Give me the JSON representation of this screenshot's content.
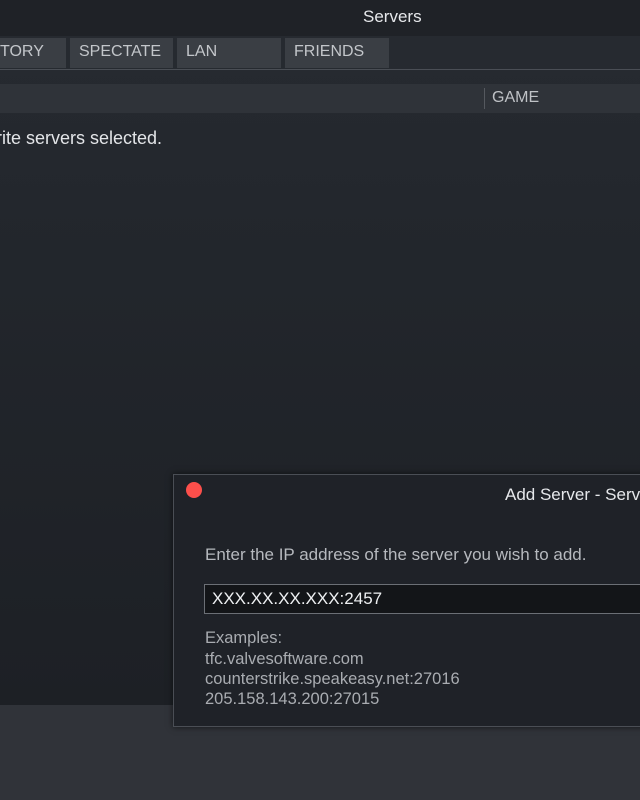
{
  "window": {
    "title": "Servers"
  },
  "tabs": [
    {
      "label": "TORY"
    },
    {
      "label": "SPECTATE"
    },
    {
      "label": "LAN"
    },
    {
      "label": "FRIENDS"
    }
  ],
  "table": {
    "columns": [
      {
        "label": "GAME"
      }
    ],
    "empty_message": "rite servers selected."
  },
  "dialog": {
    "title": "Add Server - Serv",
    "prompt": "Enter the IP address of the server you wish to add.",
    "ip_value": "XXX.XX.XX.XXX:2457",
    "examples_heading": "Examples:",
    "examples": [
      "tfc.valvesoftware.com",
      "counterstrike.speakeasy.net:27016",
      "205.158.143.200:27015"
    ]
  },
  "colors": {
    "close_button": "#fc4f4b",
    "background": "#1d2025",
    "tab_background": "#3a3e44"
  },
  "icons": {
    "close": "close-icon"
  }
}
